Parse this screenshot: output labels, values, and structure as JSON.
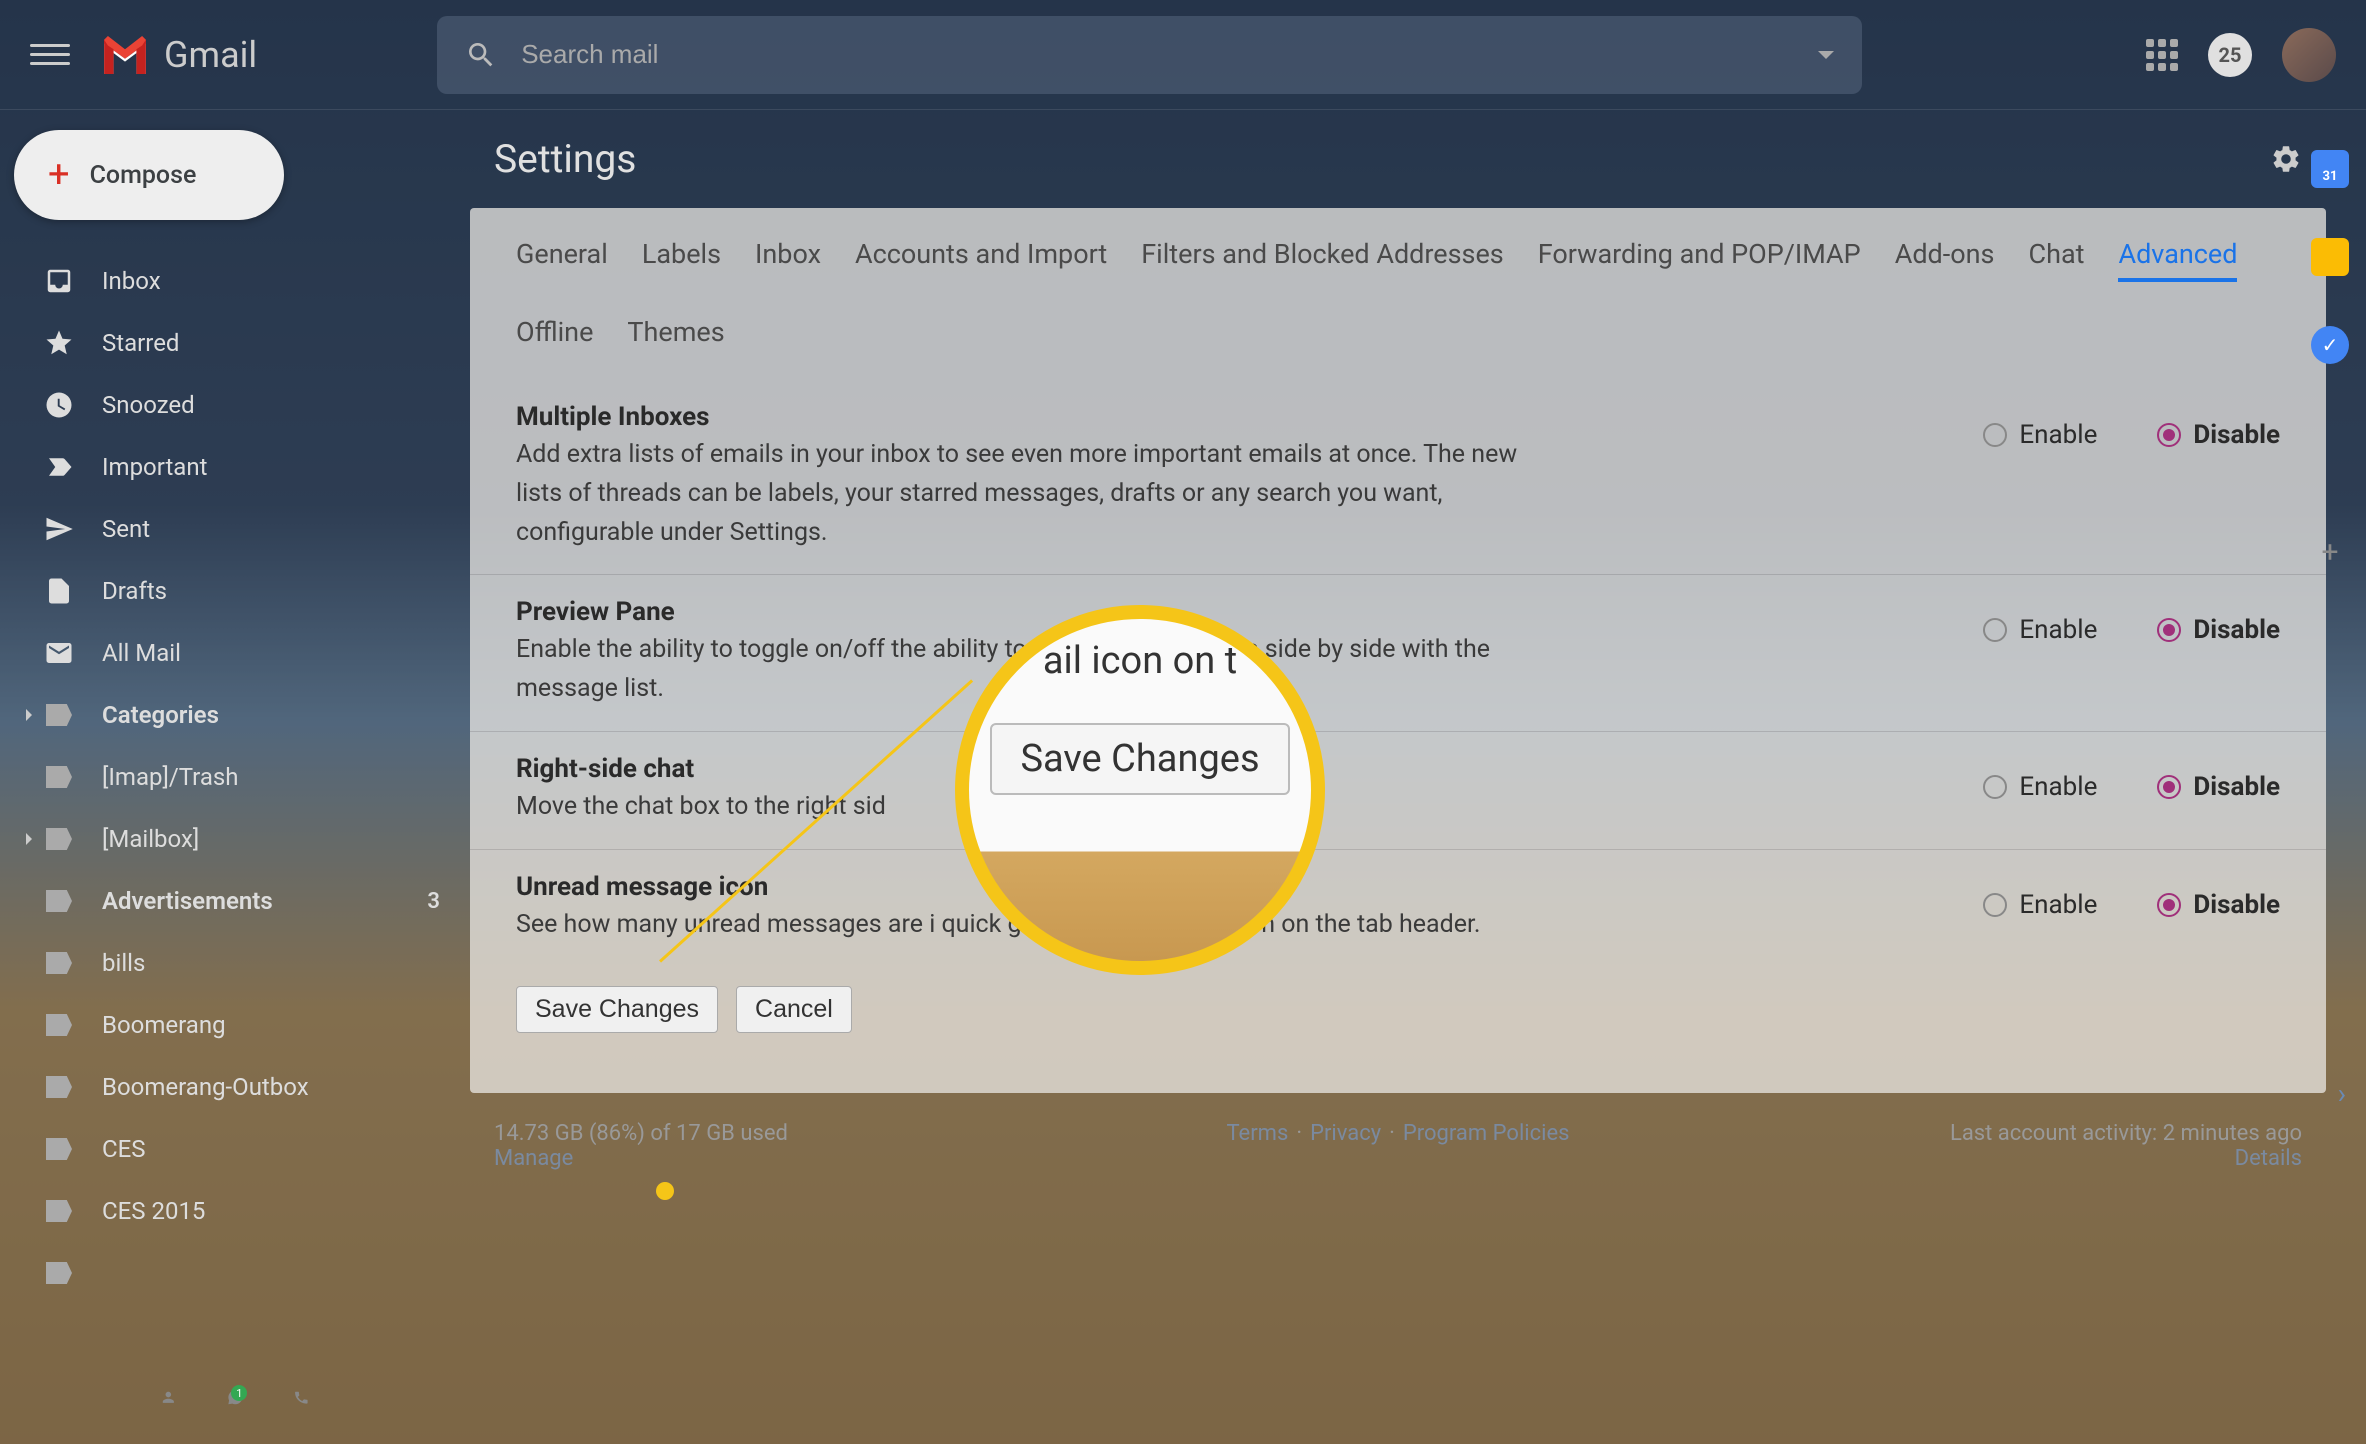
{
  "app_name": "Gmail",
  "search": {
    "placeholder": "Search mail"
  },
  "header": {
    "badge": "25"
  },
  "compose": {
    "label": "Compose"
  },
  "sidebar_items": [
    {
      "label": "Inbox",
      "icon": "inbox",
      "bold": false
    },
    {
      "label": "Starred",
      "icon": "star",
      "bold": false
    },
    {
      "label": "Snoozed",
      "icon": "clock",
      "bold": false
    },
    {
      "label": "Important",
      "icon": "important",
      "bold": false
    },
    {
      "label": "Sent",
      "icon": "send",
      "bold": false
    },
    {
      "label": "Drafts",
      "icon": "draft",
      "bold": false
    },
    {
      "label": "All Mail",
      "icon": "mail",
      "bold": false
    },
    {
      "label": "Categories",
      "icon": "label",
      "bold": true,
      "expandable": true
    },
    {
      "label": "[Imap]/Trash",
      "icon": "label",
      "bold": false
    },
    {
      "label": "[Mailbox]",
      "icon": "label",
      "bold": false,
      "expandable": true
    },
    {
      "label": "Advertisements",
      "icon": "label",
      "bold": true,
      "count": "3"
    },
    {
      "label": "bills",
      "icon": "label",
      "bold": false
    },
    {
      "label": "Boomerang",
      "icon": "label",
      "bold": false
    },
    {
      "label": "Boomerang-Outbox",
      "icon": "label",
      "bold": false
    },
    {
      "label": "CES",
      "icon": "label",
      "bold": false
    },
    {
      "label": "CES 2015",
      "icon": "label",
      "bold": false
    },
    {
      "label": "",
      "icon": "label",
      "bold": false
    }
  ],
  "settings": {
    "title": "Settings",
    "tabs": [
      "General",
      "Labels",
      "Inbox",
      "Accounts and Import",
      "Filters and Blocked Addresses",
      "Forwarding and POP/IMAP",
      "Add-ons",
      "Chat",
      "Advanced",
      "Offline",
      "Themes"
    ],
    "active_tab": "Advanced",
    "options": [
      {
        "title": "Multiple Inboxes",
        "desc": "Add extra lists of emails in your inbox to see even more important emails at once. The new lists of threads can be labels, your starred messages, drafts or any search you want, configurable under Settings.",
        "selected": "Disable"
      },
      {
        "title": "Preview Pane",
        "desc": "Enable the ability to toggle on/off the ability to view your messages side by side with the message list.",
        "selected": "Disable"
      },
      {
        "title": "Right-side chat",
        "desc": "Move the chat box to the right sid",
        "selected": "Disable"
      },
      {
        "title": "Unread message icon",
        "desc": "See how many unread messages are i                        quick glance at the Gmail icon on the tab header.",
        "selected": "Disable"
      }
    ],
    "radio_labels": {
      "enable": "Enable",
      "disable": "Disable"
    },
    "buttons": {
      "save": "Save Changes",
      "cancel": "Cancel"
    }
  },
  "footer": {
    "storage": "14.73 GB (86%) of 17 GB used",
    "manage": "Manage",
    "links": [
      "Terms",
      "Privacy",
      "Program Policies"
    ],
    "activity": "Last account activity: 2 minutes ago",
    "details": "Details"
  },
  "callout": {
    "text_fragment": "ail icon on t",
    "button": "Save Changes"
  },
  "rail": {
    "calendar_day": "31"
  }
}
